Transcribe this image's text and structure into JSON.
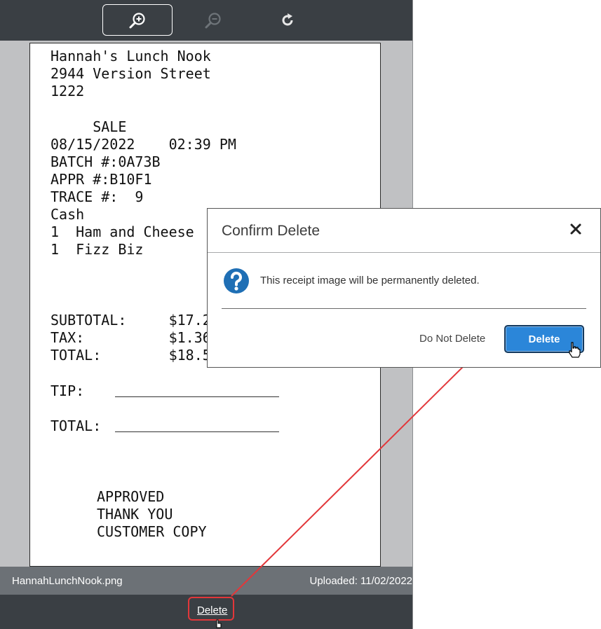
{
  "toolbar": {
    "zoom_in_icon": "zoom-in-icon",
    "zoom_out_icon": "zoom-out-icon",
    "rotate_icon": "rotate-icon"
  },
  "receipt": {
    "lines": [
      "Hannah's Lunch Nook",
      "2944 Version Street",
      "1222",
      "     SALE",
      "08/15/2022    02:39 PM",
      "BATCH #:0A73B",
      "APPR #:B10F1",
      "TRACE #:  9",
      "Cash",
      "1  Ham and Cheese",
      "1  Fizz Biz",
      "SUBTOTAL:     $17.21",
      "TAX:          $1.36",
      "TOTAL:        $18.57",
      "TIP:",
      "TOTAL:",
      "APPROVED",
      "THANK YOU",
      "CUSTOMER COPY"
    ]
  },
  "meta": {
    "file_name": "HannahLunchNook.png",
    "uploaded": "Uploaded: 11/02/2022"
  },
  "bottom": {
    "delete_label": "Delete"
  },
  "dialog": {
    "title": "Confirm Delete",
    "close_glyph": "✕",
    "message": "This receipt image will be permanently deleted.",
    "cancel_label": "Do Not Delete",
    "confirm_label": "Delete"
  },
  "colors": {
    "accent": "#2b86d9",
    "highlight": "#e2373a",
    "toolbar": "#3a3f44"
  }
}
